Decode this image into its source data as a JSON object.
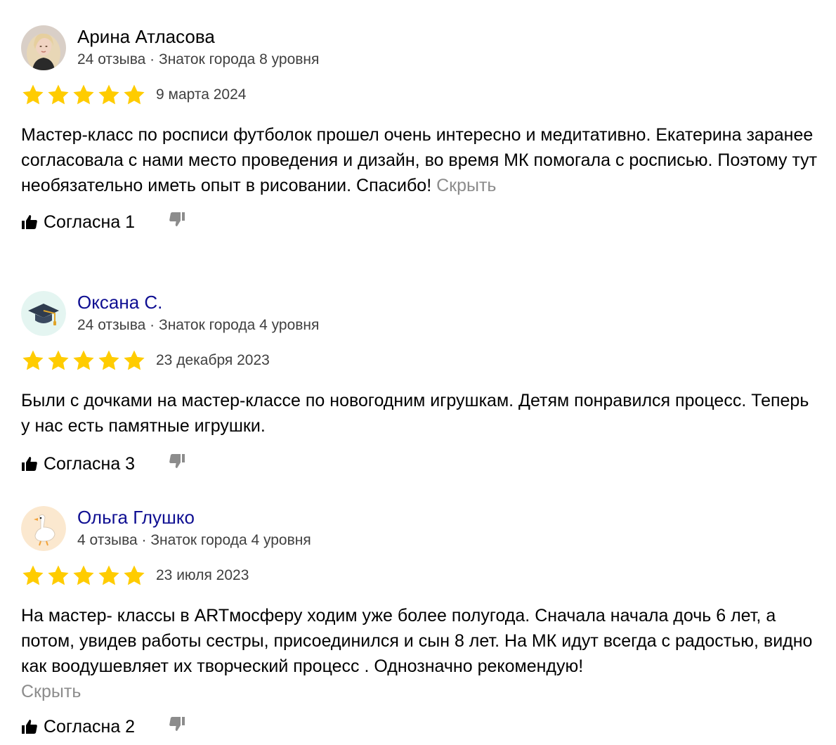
{
  "reviews": [
    {
      "author": "Арина Атласова",
      "meta": "24 отзыва · Знаток города 8 уровня",
      "avatar": "woman-photo-avatar",
      "rating": 5,
      "date": "9 марта 2024",
      "text": "Мастер-класс по росписи футболок прошел очень интересно и медитативно. Екатерина заранее согласовала с нами место проведения и дизайн, во время МК помогала с росписью. Поэтому тут необязательно иметь опыт в рисовании. Спасибо!",
      "hide_label": "Скрыть",
      "like_label": "Согласна 1"
    },
    {
      "author": "Оксана С.",
      "meta": "24 отзыва · Знаток города 4 уровня",
      "avatar": "graduation-cap-avatar",
      "rating": 5,
      "date": "23 декабря 2023",
      "text": "Были с дочками на мастер-классе по новогодним игрушкам. Детям понравился процесс. Теперь у нас есть памятные игрушки.",
      "like_label": "Согласна 3"
    },
    {
      "author": "Ольга Глушко",
      "meta": "4 отзыва · Знаток города 4 уровня",
      "avatar": "goose-avatar",
      "rating": 5,
      "date": "23 июля 2023",
      "text": "На мастер- классы в ARTмосферу ходим уже более полугода. Сначала начала дочь 6 лет, а потом, увидев работы сестры, присоединился и сын 8 лет. На МК идут всегда с радостью, видно как воодушевляет их творческий процесс . Однозначно рекомендую!",
      "hide_label": "Скрыть",
      "like_label": "Согласна 2"
    }
  ],
  "colors": {
    "star": "#fc0",
    "author_link": "#0f0f92",
    "meta_text": "#404040",
    "hide_link": "#8c8c8c",
    "dislike_icon": "#8c8c8c"
  }
}
